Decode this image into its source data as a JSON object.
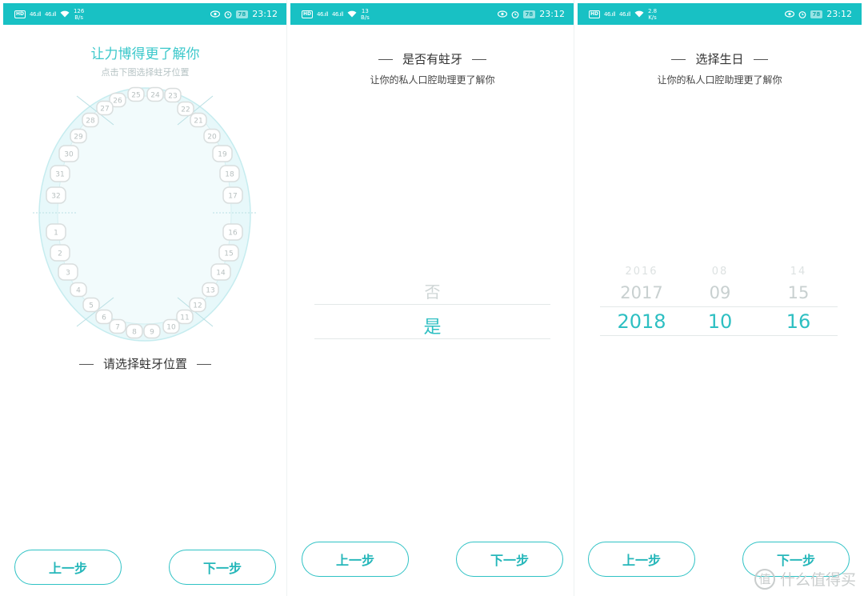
{
  "status_bar": {
    "hd": "HD",
    "signal": "46.ıll",
    "screens": [
      {
        "speed_value": "126",
        "speed_unit": "B/s",
        "battery": "78",
        "time": "23:12"
      },
      {
        "speed_value": "13",
        "speed_unit": "B/s",
        "battery": "78",
        "time": "23:12"
      },
      {
        "speed_value": "2.8",
        "speed_unit": "K/s",
        "battery": "78",
        "time": "23:12"
      }
    ],
    "accent_color": "#18c1c4"
  },
  "screen1": {
    "title": "让力博得更了解你",
    "subtitle": "点击下图选择蛀牙位置",
    "teeth": [
      "1",
      "2",
      "3",
      "4",
      "5",
      "6",
      "7",
      "8",
      "9",
      "10",
      "11",
      "12",
      "13",
      "14",
      "15",
      "16",
      "17",
      "18",
      "19",
      "20",
      "21",
      "22",
      "23",
      "24",
      "25",
      "26",
      "27",
      "28",
      "29",
      "30",
      "31",
      "32"
    ],
    "heading": "请选择蛀牙位置",
    "prev_label": "上一步",
    "next_label": "下一步"
  },
  "screen2": {
    "heading": "是否有蛀牙",
    "subtitle": "让你的私人口腔助理更了解你",
    "options": [
      "否",
      "是"
    ],
    "selected": "是",
    "prev_label": "上一步",
    "next_label": "下一步"
  },
  "screen3": {
    "heading": "选择生日",
    "subtitle": "让你的私人口腔助理更了解你",
    "year": {
      "faint": "2016",
      "near": "2017",
      "selected": "2018"
    },
    "month": {
      "faint": "08",
      "near": "09",
      "selected": "10"
    },
    "day": {
      "faint": "14",
      "near": "15",
      "selected": "16"
    },
    "prev_label": "上一步",
    "next_label": "下一步"
  },
  "watermark": {
    "icon": "值",
    "text": "什么值得买"
  }
}
